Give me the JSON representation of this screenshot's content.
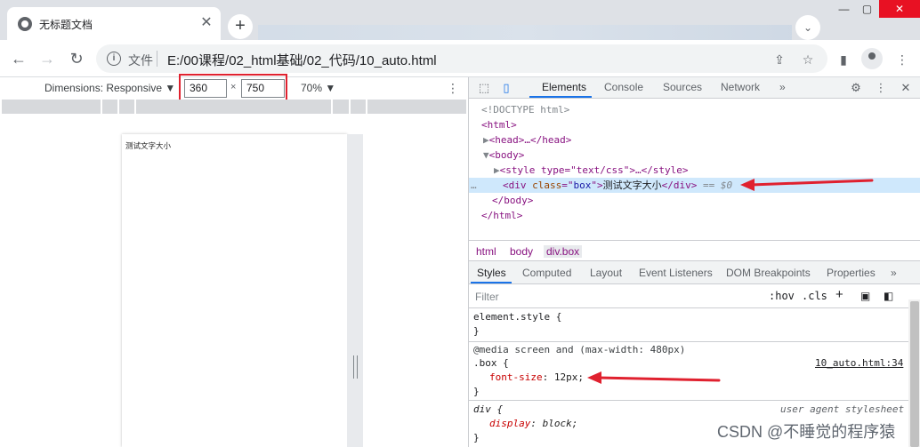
{
  "browser": {
    "tab_title": "无标题文档",
    "tab_close": "✕",
    "new_tab": "+",
    "window_controls": [
      "—",
      "▢",
      "✕"
    ],
    "file_label": "文件",
    "url": "E:/00课程/02_html基础/02_代码/10_auto.html"
  },
  "device_toolbar": {
    "dimensions_label": "Dimensions: Responsive ▼",
    "width": "360",
    "times": "×",
    "height": "750",
    "zoom": "70% ▼",
    "menu": "⋮"
  },
  "viewport": {
    "page_text": "测试文字大小"
  },
  "devtools": {
    "tabs": [
      "Elements",
      "Console",
      "Sources",
      "Network",
      "»"
    ],
    "dom": {
      "doctype": "<!DOCTYPE html>",
      "html_open": "<html>",
      "head": "<head>…</head>",
      "body_open": "<body>",
      "style_tag": "<style type=\"text/css\">…</style>",
      "div_open": "<div class=\"box\">",
      "div_tag": "div",
      "div_attr": "class",
      "div_attr_val": "box",
      "div_text": "测试文字大小",
      "div_close": "</div>",
      "eq_sign": "== $0",
      "ellipsis": "…",
      "body_close": "</body>",
      "html_close": "</html>"
    },
    "breadcrumbs": [
      "html",
      "body",
      "div.box"
    ],
    "styles_tabs": [
      "Styles",
      "Computed",
      "Layout",
      "Event Listeners",
      "DOM Breakpoints",
      "Properties",
      "»"
    ],
    "filter_placeholder": "Filter",
    "filter_hov": ":hov",
    "filter_cls": ".cls",
    "filter_plus": "+",
    "rules": {
      "element_style_open": "element.style {",
      "element_style_close": "}",
      "media_query": "@media screen and (max-width: 480px)",
      "box_selector": ".box {",
      "box_source": "10_auto.html:34",
      "box_prop": "font-size",
      "box_value": "12px;",
      "box_close": "}",
      "div_selector": "div {",
      "div_source": "user agent stylesheet",
      "div_prop": "display",
      "div_value": "block;",
      "div_close": "}"
    }
  },
  "watermark": "CSDN @不睡觉的程序猿",
  "colors": {
    "accent": "#1a73e8",
    "highlight_red": "#e0212f",
    "tag": "#881280"
  }
}
